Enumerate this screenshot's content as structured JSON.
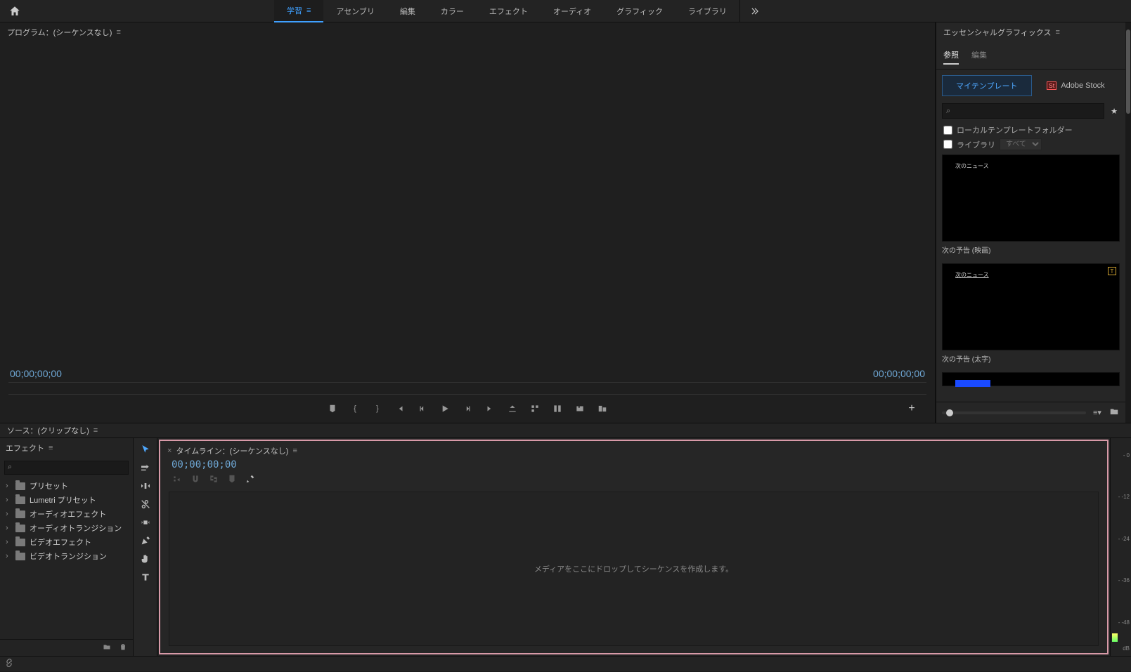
{
  "workspaces": {
    "items": [
      "学習",
      "アセンブリ",
      "編集",
      "カラー",
      "エフェクト",
      "オーディオ",
      "グラフィック",
      "ライブラリ"
    ],
    "activeIndex": 0
  },
  "programPanel": {
    "title": "プログラム：(シーケンスなし)",
    "timecodeLeft": "00;00;00;00",
    "timecodeRight": "00;00;00;00"
  },
  "essentialGraphics": {
    "title": "エッセンシャルグラフィックス",
    "tabs": {
      "browse": "参照",
      "edit": "編集"
    },
    "sourceTabs": {
      "myTemplates": "マイテンプレート",
      "adobeStock": "Adobe Stock",
      "stBadge": "St"
    },
    "searchPlaceholder": "",
    "checks": {
      "localFolder": "ローカルテンプレートフォルダー",
      "library": "ライブラリ",
      "librarySelect": "すべて"
    },
    "templates": [
      {
        "label": "次の予告 (映画)",
        "thumbText": "次のニュース"
      },
      {
        "label": "次の予告 (太字)",
        "thumbText": "次のニュース"
      }
    ]
  },
  "sourcePanel": {
    "title": "ソース：(クリップなし)"
  },
  "effectsPanel": {
    "title": "エフェクト",
    "items": [
      "プリセット",
      "Lumetri プリセット",
      "オーディオエフェクト",
      "オーディオトランジション",
      "ビデオエフェクト",
      "ビデオトランジション"
    ]
  },
  "timelinePanel": {
    "title": "タイムライン：(シーケンスなし)",
    "timecode": "00;00;00;00",
    "dropHint": "メディアをここにドロップしてシーケンスを作成します。"
  },
  "audioMeter": {
    "ticks": [
      0,
      -12,
      -24,
      -36,
      -48
    ],
    "unit": "dB"
  }
}
